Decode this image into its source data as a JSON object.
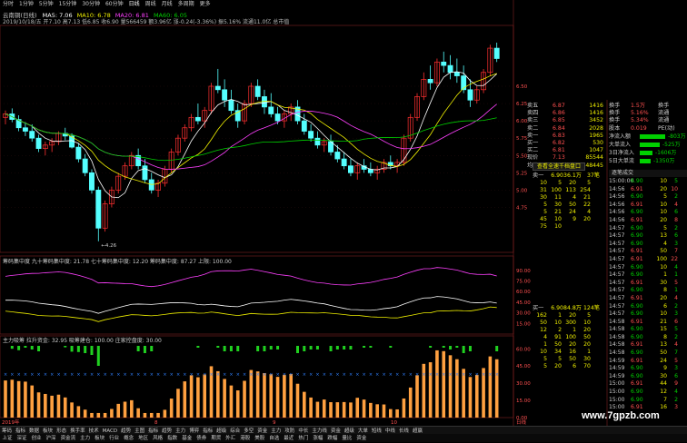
{
  "periods": [
    "分时",
    "1分钟",
    "5分钟",
    "15分钟",
    "30分钟",
    "60分钟",
    "日线",
    "周线",
    "月线",
    "多周期",
    "更多"
  ],
  "active_period": "日线",
  "ma_line": {
    "name": "云南铜(日线)",
    "ma5": "MA5: 7.06",
    "ma10": "MA10: 6.78",
    "ma20": "MA20: 6.81",
    "ma60": "MA60: 6.05"
  },
  "info_line": "2019/10/18/五  开7.10  高7.13  低6.85  收6.90  量566459  额3.96亿  涨-0.24(-3.36%)  振5.16%  流通11.0亿  总市值",
  "kline": {
    "price_labels": [
      "6.50",
      "6.25",
      "6.00",
      "5.75",
      "5.50",
      "5.25",
      "5.00",
      "4.75"
    ],
    "low_label": "4.26",
    "candles": [
      [
        6.05,
        6.15,
        5.95,
        6.1
      ],
      [
        6.1,
        6.18,
        5.98,
        6.02
      ],
      [
        6.02,
        6.08,
        5.85,
        5.9
      ],
      [
        5.9,
        5.98,
        5.78,
        5.85
      ],
      [
        5.85,
        5.95,
        5.7,
        5.75
      ],
      [
        5.75,
        5.8,
        5.55,
        5.6
      ],
      [
        5.6,
        5.7,
        5.5,
        5.65
      ],
      [
        5.65,
        5.75,
        5.55,
        5.7
      ],
      [
        5.7,
        5.85,
        5.65,
        5.82
      ],
      [
        5.82,
        5.9,
        5.72,
        5.78
      ],
      [
        5.78,
        5.82,
        5.6,
        5.62
      ],
      [
        5.62,
        5.68,
        5.4,
        5.45
      ],
      [
        5.45,
        5.52,
        5.2,
        5.25
      ],
      [
        5.25,
        5.3,
        4.95,
        5.0
      ],
      [
        5.0,
        5.05,
        4.26,
        4.45
      ],
      [
        4.45,
        4.85,
        4.4,
        4.8
      ],
      [
        4.8,
        5.05,
        4.75,
        5.0
      ],
      [
        5.0,
        5.25,
        4.95,
        5.2
      ],
      [
        5.2,
        5.4,
        5.15,
        5.35
      ],
      [
        5.35,
        5.55,
        5.3,
        5.5
      ],
      [
        5.5,
        5.6,
        5.3,
        5.35
      ],
      [
        5.35,
        5.45,
        5.1,
        5.15
      ],
      [
        5.15,
        5.25,
        4.95,
        5.0
      ],
      [
        5.0,
        5.15,
        4.9,
        5.1
      ],
      [
        5.1,
        5.35,
        5.05,
        5.3
      ],
      [
        5.3,
        5.6,
        5.25,
        5.55
      ],
      [
        5.55,
        5.8,
        5.5,
        5.75
      ],
      [
        5.75,
        5.95,
        5.7,
        5.9
      ],
      [
        5.9,
        6.1,
        5.85,
        6.05
      ],
      [
        6.05,
        6.25,
        5.95,
        6.0
      ],
      [
        6.0,
        6.2,
        5.9,
        6.15
      ],
      [
        6.15,
        6.55,
        6.1,
        6.5
      ],
      [
        6.5,
        6.75,
        6.4,
        6.45
      ],
      [
        6.45,
        6.6,
        6.2,
        6.3
      ],
      [
        6.3,
        6.45,
        6.1,
        6.15
      ],
      [
        6.15,
        6.25,
        5.9,
        6.0
      ],
      [
        6.0,
        6.3,
        5.95,
        6.25
      ],
      [
        6.25,
        6.55,
        6.2,
        6.5
      ],
      [
        6.5,
        6.6,
        6.3,
        6.35
      ],
      [
        6.35,
        6.45,
        6.1,
        6.2
      ],
      [
        6.2,
        6.4,
        6.05,
        6.1
      ],
      [
        6.1,
        6.2,
        5.95,
        6.0
      ],
      [
        6.0,
        6.15,
        5.9,
        6.1
      ],
      [
        6.1,
        6.25,
        6.0,
        6.2
      ],
      [
        6.2,
        6.3,
        5.95,
        6.0
      ],
      [
        6.0,
        6.1,
        5.8,
        5.85
      ],
      [
        5.85,
        5.95,
        5.7,
        5.75
      ],
      [
        5.75,
        5.85,
        5.6,
        5.65
      ],
      [
        5.65,
        5.75,
        5.55,
        5.7
      ],
      [
        5.7,
        5.8,
        5.5,
        5.55
      ],
      [
        5.55,
        5.65,
        5.4,
        5.45
      ],
      [
        5.45,
        5.55,
        5.3,
        5.35
      ],
      [
        5.35,
        5.45,
        5.2,
        5.25
      ],
      [
        5.25,
        5.4,
        5.15,
        5.35
      ],
      [
        5.35,
        5.45,
        5.25,
        5.3
      ],
      [
        5.3,
        5.4,
        5.2,
        5.25
      ],
      [
        5.25,
        5.35,
        5.15,
        5.3
      ],
      [
        5.3,
        5.45,
        5.25,
        5.4
      ],
      [
        5.4,
        5.5,
        5.3,
        5.35
      ],
      [
        5.35,
        5.45,
        5.25,
        5.4
      ],
      [
        5.4,
        5.8,
        5.35,
        5.75
      ],
      [
        5.75,
        6.1,
        5.7,
        6.05
      ],
      [
        6.05,
        6.4,
        6.0,
        6.35
      ],
      [
        6.35,
        6.7,
        6.3,
        6.6
      ],
      [
        6.6,
        6.8,
        6.45,
        6.55
      ],
      [
        6.55,
        6.9,
        6.5,
        6.85
      ],
      [
        6.85,
        7.0,
        6.7,
        6.8
      ],
      [
        6.8,
        6.95,
        6.6,
        6.7
      ],
      [
        6.7,
        6.9,
        6.55,
        6.65
      ],
      [
        6.65,
        6.8,
        6.4,
        6.45
      ],
      [
        6.45,
        6.6,
        6.2,
        6.3
      ],
      [
        6.3,
        6.5,
        6.25,
        6.45
      ],
      [
        6.45,
        6.75,
        6.4,
        6.7
      ],
      [
        6.7,
        7.1,
        6.65,
        7.05
      ],
      [
        7.05,
        7.13,
        6.85,
        6.9
      ]
    ]
  },
  "ind1": {
    "title": "筹码集中度  九十筹码集中度: 21.78  七十筹码集中度: 12.20  筹码集中度: 87.27  上限: 100.00",
    "labels": [
      "90.00",
      "75.00",
      "60.00",
      "45.00",
      "30.00",
      "15.00"
    ]
  },
  "ind2": {
    "title": "主力吸筹  拉升资金: 32.95  吸筹建仓: 100.00  庄家控盘度: 30.00",
    "labels": [
      "60.00",
      "45.00",
      "30.00",
      "15.00",
      "0.00"
    ]
  },
  "date_axis": {
    "start": "2019年",
    "m8": "8",
    "m9": "9",
    "m10": "10",
    "end": "日线"
  },
  "orderbook": [
    {
      "label": "卖五",
      "price": "6.87",
      "vol": "1416"
    },
    {
      "label": "卖四",
      "price": "6.86",
      "vol": "1416"
    },
    {
      "label": "卖三",
      "price": "6.85",
      "vol": "3452"
    },
    {
      "label": "卖二",
      "price": "6.84",
      "vol": "2028"
    },
    {
      "label": "卖一",
      "price": "6.83",
      "vol": "1965"
    },
    {
      "label": "买一",
      "price": "6.82",
      "vol": "530"
    },
    {
      "label": "买二",
      "price": "6.81",
      "vol": "1047"
    },
    {
      "label": "现价",
      "price": "7.13",
      "vol": "85544"
    },
    {
      "label": "均价",
      "price": "6.91",
      "vol": "48445"
    }
  ],
  "stats": [
    {
      "a": "换手",
      "b": "1.5万",
      "c": "换手"
    },
    {
      "a": "换手",
      "b": "5.16%",
      "c": "流通"
    },
    {
      "a": "换手",
      "b": "5.34%",
      "c": "流通"
    },
    {
      "a": "股本",
      "b": "0.019",
      "c": "PE(动)"
    }
  ],
  "flows": [
    {
      "label": "净流入额",
      "value": "-803万",
      "color": "#00d000",
      "w": 28
    },
    {
      "label": "大单流入",
      "value": "-525万",
      "color": "#00d000",
      "w": 22
    },
    {
      "label": "3日净流入",
      "value": "-1606万",
      "color": "#00d000",
      "w": 14
    },
    {
      "label": "5日大单流",
      "value": "-1350万",
      "color": "#00d000",
      "w": 12
    }
  ],
  "summary_caption": "查看全速千档盘口",
  "sell_header": [
    "卖一",
    "6.90",
    "36.1万",
    "37笔"
  ],
  "sell_grid": [
    [
      "10",
      "5",
      "20",
      "5"
    ],
    [
      "31",
      "100",
      "113",
      "254"
    ],
    [
      "30",
      "11",
      "4",
      "21"
    ],
    [
      "5",
      "30",
      "50",
      "22"
    ],
    [
      "5",
      "21",
      "24",
      "4"
    ],
    [
      "45",
      "10",
      "9",
      "20"
    ],
    [
      "75",
      "10",
      "",
      ""
    ]
  ],
  "buy_header": [
    "买一",
    "6.90",
    "84.8万",
    "124笔"
  ],
  "buy_grid": [
    [
      "162",
      "1",
      "20",
      "5"
    ],
    [
      "50",
      "10",
      "300",
      "10"
    ],
    [
      "12",
      "2",
      "1",
      "20"
    ],
    [
      "4",
      "91",
      "100",
      "50"
    ],
    [
      "1",
      "50",
      "20",
      "20"
    ],
    [
      "10",
      "34",
      "16",
      "1"
    ],
    [
      "5",
      "5",
      "50",
      "30"
    ],
    [
      "5",
      "20",
      "6",
      "70"
    ]
  ],
  "tick_header": "逐笔成交",
  "ticks": [
    [
      "15:00:00",
      "6.90",
      "10",
      "5"
    ],
    [
      "14:56",
      "6.91",
      "20",
      "10"
    ],
    [
      "14:56",
      "6.90",
      "5",
      "2"
    ],
    [
      "14:56",
      "6.91",
      "10",
      "4"
    ],
    [
      "14:56",
      "6.90",
      "10",
      "6"
    ],
    [
      "14:56",
      "6.91",
      "20",
      "8"
    ],
    [
      "14:57",
      "6.90",
      "5",
      "2"
    ],
    [
      "14:57",
      "6.90",
      "13",
      "6"
    ],
    [
      "14:57",
      "6.90",
      "4",
      "3"
    ],
    [
      "14:57",
      "6.91",
      "50",
      "7"
    ],
    [
      "14:57",
      "6.91",
      "100",
      "22"
    ],
    [
      "14:57",
      "6.90",
      "10",
      "4"
    ],
    [
      "14:57",
      "6.90",
      "1",
      "1"
    ],
    [
      "14:57",
      "6.91",
      "30",
      "5"
    ],
    [
      "14:57",
      "6.90",
      "8",
      "1"
    ],
    [
      "14:57",
      "6.91",
      "20",
      "4"
    ],
    [
      "14:57",
      "6.90",
      "6",
      "2"
    ],
    [
      "14:57",
      "6.90",
      "10",
      "3"
    ],
    [
      "14:58",
      "6.91",
      "21",
      "6"
    ],
    [
      "14:58",
      "6.90",
      "15",
      "5"
    ],
    [
      "14:58",
      "6.90",
      "8",
      "2"
    ],
    [
      "14:58",
      "6.91",
      "13",
      "4"
    ],
    [
      "14:58",
      "6.90",
      "50",
      "7"
    ],
    [
      "14:59",
      "6.91",
      "24",
      "5"
    ],
    [
      "14:59",
      "6.90",
      "9",
      "3"
    ],
    [
      "14:59",
      "6.90",
      "30",
      "6"
    ],
    [
      "15:00",
      "6.91",
      "44",
      "9"
    ],
    [
      "15:00",
      "6.90",
      "12",
      "4"
    ],
    [
      "15:00",
      "6.90",
      "7",
      "2"
    ],
    [
      "15:00",
      "6.91",
      "16",
      "3"
    ]
  ],
  "bottom_tabs": [
    "筹码",
    "指标",
    "数据",
    "板块",
    "形态",
    "换手率",
    "技术",
    "MACD",
    "趋势",
    "主图",
    "指标",
    "趋势",
    "主力",
    "博弈",
    "指标",
    "超级",
    "综合",
    "多空",
    "资金",
    "主力",
    "攻防",
    "中长",
    "主力线",
    "资金",
    "超级",
    "大单",
    "短线",
    "中线",
    "长线",
    "超赢"
  ],
  "status_tabs": [
    "上证",
    "深证",
    "创业",
    "沪深",
    "资金流",
    "主力",
    "板块",
    "行业",
    "概念",
    "地区",
    "风格",
    "指数",
    "基金",
    "债券",
    "期货",
    "外汇",
    "港股",
    "美股",
    "自选",
    "最近",
    "热门",
    "涨幅",
    "跌幅",
    "量比",
    "资金"
  ],
  "watermark": "www.7gpzb.com"
}
